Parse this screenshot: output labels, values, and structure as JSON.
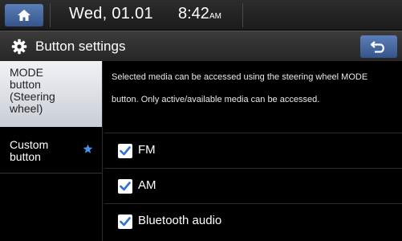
{
  "status_bar": {
    "date": "Wed, 01.01",
    "time": "8:42",
    "ampm": "AM"
  },
  "title_bar": {
    "title": "Button settings"
  },
  "sidebar": {
    "items": [
      {
        "label": "MODE button (Steering wheel)",
        "lines": [
          "MODE",
          "button",
          "(Steering",
          "wheel)"
        ],
        "selected": true
      },
      {
        "label": "Custom button",
        "lines": [
          "Custom",
          "button"
        ],
        "selected": false
      }
    ]
  },
  "content": {
    "description": "Selected media can be accessed using the steering wheel MODE button. Only active/available media can be accessed.",
    "options": [
      {
        "label": "FM",
        "checked": true
      },
      {
        "label": "AM",
        "checked": true
      },
      {
        "label": "Bluetooth audio",
        "checked": true
      }
    ]
  },
  "colors": {
    "accent_blue": "#36548a",
    "checkbox_blue": "#2f6fd6",
    "selected_bg": "#dfe3ea"
  }
}
